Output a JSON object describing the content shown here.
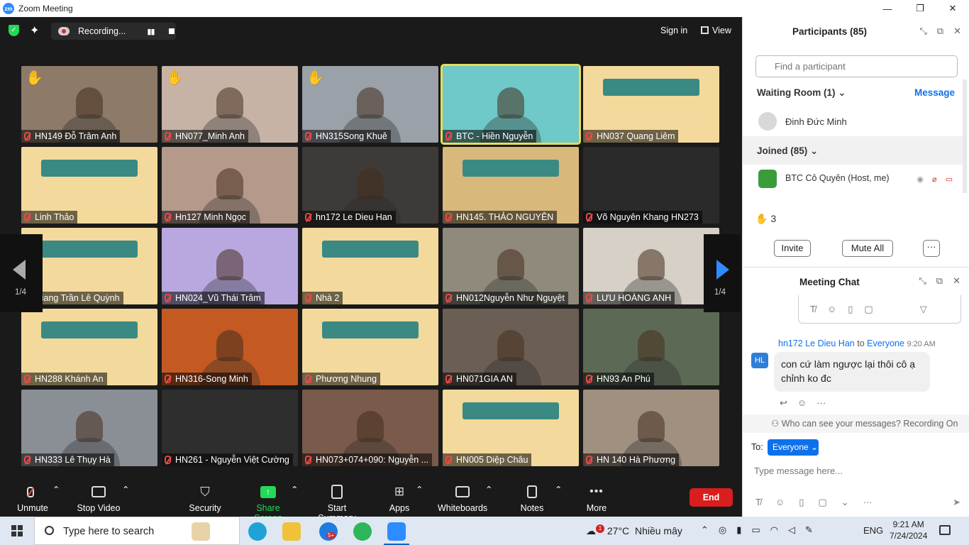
{
  "titlebar": {
    "logo": "zm",
    "title": "Zoom Meeting",
    "min": "—",
    "restore": "❐",
    "close": "✕"
  },
  "topbar": {
    "recording_label": "Recording...",
    "sign_in": "Sign in",
    "view": "View"
  },
  "gallery": {
    "page_left": "1/4",
    "page_right": "1/4",
    "tiles": [
      {
        "name": "HN149 Đỗ Trâm Anh",
        "bg": "#8d7a68",
        "hand": true
      },
      {
        "name": "HN077_Minh Anh",
        "bg": "#c7b3a6",
        "hand": true
      },
      {
        "name": "HN315Song Khuê",
        "bg": "#9aa1a8",
        "hand": true
      },
      {
        "name": "BTC - Hiền Nguyễn",
        "bg": "#6fc9c8",
        "hand": false,
        "active": true
      },
      {
        "name": "HN037 Quang Liêm",
        "bg": "#f3d99b",
        "summer": true
      },
      {
        "name": "Linh Thảo",
        "bg": "#f3d99b",
        "summer": true
      },
      {
        "name": "Hn127 Minh Ngọc",
        "bg": "#b59a8c"
      },
      {
        "name": "hn172 Le Dieu Han",
        "bg": "#3e3a38"
      },
      {
        "name": "HN145. THẢO NGUYÊN",
        "bg": "#d9b87c",
        "summer": true
      },
      {
        "name": "Võ Nguyên Khang HN273",
        "bg": "#2a2a2a"
      },
      {
        "name": "Giang Trần Lê Quỳnh",
        "bg": "#f3d99b",
        "summer": true
      },
      {
        "name": "HN024_Vũ Thái Trâm",
        "bg": "#b9a8e0"
      },
      {
        "name": "Nhà 2",
        "bg": "#f3d99b",
        "summer": true
      },
      {
        "name": "HN012Nguyễn Như Nguyệt",
        "bg": "#8f8a7c"
      },
      {
        "name": "LƯU HOÀNG ANH",
        "bg": "#d6d0c6"
      },
      {
        "name": "HN288 Khánh An",
        "bg": "#f3d99b",
        "summer": true
      },
      {
        "name": "HN316-Song Minh",
        "bg": "#c45a22"
      },
      {
        "name": "Phương Nhung",
        "bg": "#f3d99b",
        "summer": true
      },
      {
        "name": "HN071GIA AN",
        "bg": "#6b5f55"
      },
      {
        "name": "HN93 An Phú",
        "bg": "#5c6a55"
      },
      {
        "name": "HN333 Lê Thụy Hà",
        "bg": "#8a8f96"
      },
      {
        "name": "HN261 - Nguyễn Việt Cường",
        "bg": "#2e2e2e"
      },
      {
        "name": "HN073+074+090: Nguyễn ...",
        "bg": "#7a5a4a"
      },
      {
        "name": "HN005 Diệp Châu",
        "bg": "#f3d99b",
        "summer": true
      },
      {
        "name": "HN 140 Hà Phương",
        "bg": "#a09080"
      }
    ]
  },
  "toolbar": {
    "unmute": "Unmute",
    "stop_video": "Stop Video",
    "security": "Security",
    "share_screen": "Share Screen",
    "start_summary": "Start Summary",
    "apps": "Apps",
    "whiteboards": "Whiteboards",
    "notes": "Notes",
    "more": "More",
    "end": "End"
  },
  "participants": {
    "title": "Participants (85)",
    "search_placeholder": "Find a participant",
    "waiting_room": "Waiting Room (1)",
    "message": "Message",
    "waiting_person": "Đinh Đức Minh",
    "joined": "Joined (85)",
    "host": "BTC Cô Quyên (Host, me)",
    "raised_count": "3",
    "invite": "Invite",
    "mute_all": "Mute All",
    "more": "···"
  },
  "chat": {
    "title": "Meeting Chat",
    "sender": "hn172 Le Dieu Han",
    "to_word": "to",
    "recipient": "Everyone",
    "time": "9:20 AM",
    "avatar": "HL",
    "message": "con cứ làm ngược lại thôi cô ạ chỉnh ko đc",
    "who_can_see": "Who can see your messages? Recording On",
    "to_label": "To:",
    "to_value": "Everyone",
    "input_placeholder": "Type message here..."
  },
  "taskbar": {
    "search": "Type here to search",
    "temp": "27°C",
    "weather": "Nhiều mây",
    "weather_badge": "1",
    "lang": "ENG",
    "time": "9:21 AM",
    "date": "7/24/2024",
    "zalo_badge": "5+"
  }
}
